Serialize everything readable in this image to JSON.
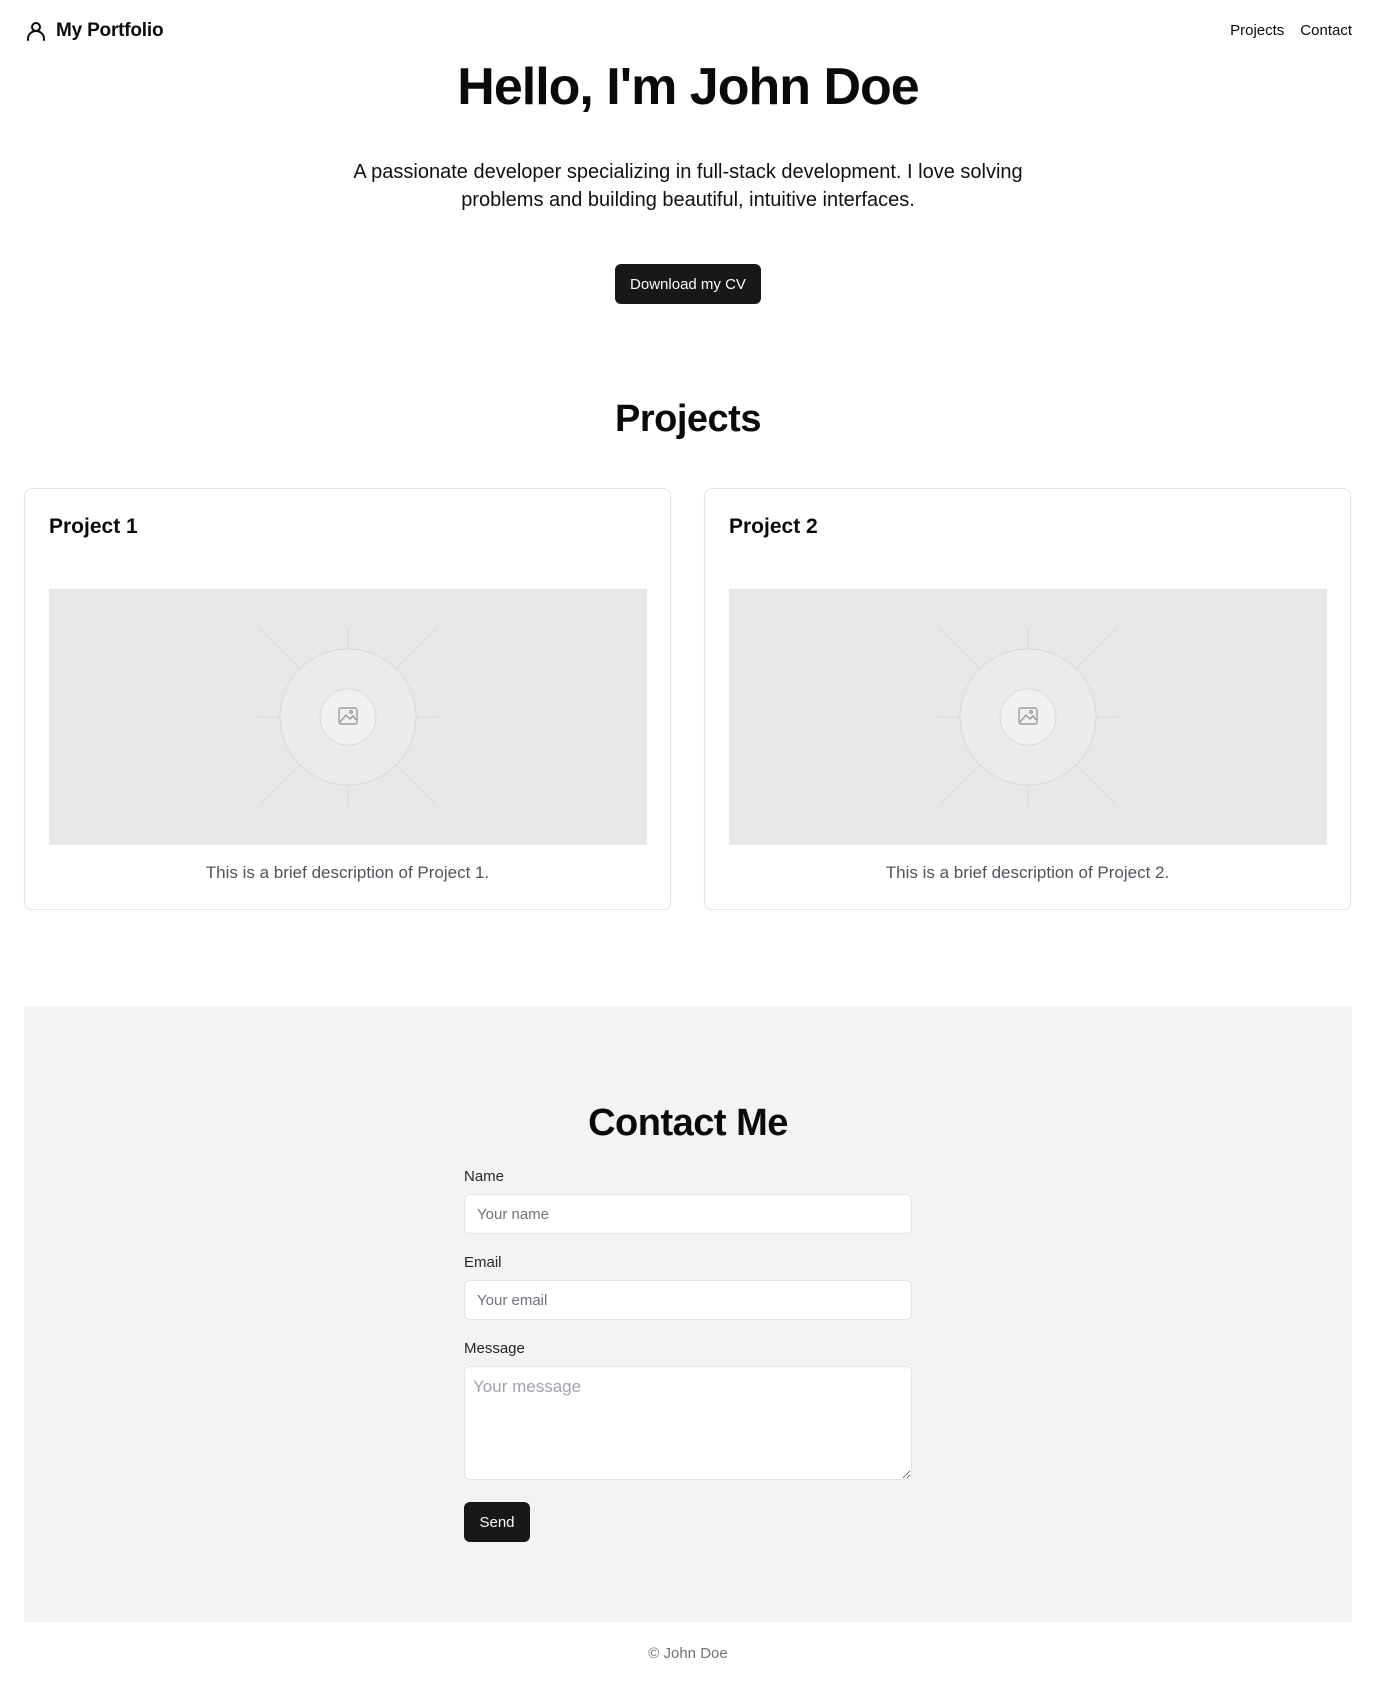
{
  "nav": {
    "brand": "My Portfolio",
    "brand_icon": "user-icon",
    "links": [
      "Projects",
      "Contact"
    ]
  },
  "hero": {
    "title": "Hello, I'm John Doe",
    "description": "A passionate developer specializing in full-stack development. I love solving problems and building beautiful, intuitive interfaces.",
    "cv_button": "Download my CV"
  },
  "projects": {
    "title": "Projects",
    "items": [
      {
        "title": "Project 1",
        "description": "This is a brief description of Project 1.",
        "image_icon": "image-placeholder-icon"
      },
      {
        "title": "Project 2",
        "description": "This is a brief description of Project 2.",
        "image_icon": "image-placeholder-icon"
      }
    ]
  },
  "contact": {
    "title": "Contact Me",
    "name_label": "Name",
    "name_placeholder": "Your name",
    "name_value": "",
    "email_label": "Email",
    "email_placeholder": "Your email",
    "email_value": "",
    "message_label": "Message",
    "message_placeholder": "Your message",
    "message_value": "",
    "send_label": "Send"
  },
  "footer": {
    "text": "© John Doe"
  },
  "colors": {
    "primary_button": "#18181b",
    "contact_background": "#f2f3f5",
    "image_placeholder": "#e8e8e8",
    "muted_text": "#52525b"
  }
}
